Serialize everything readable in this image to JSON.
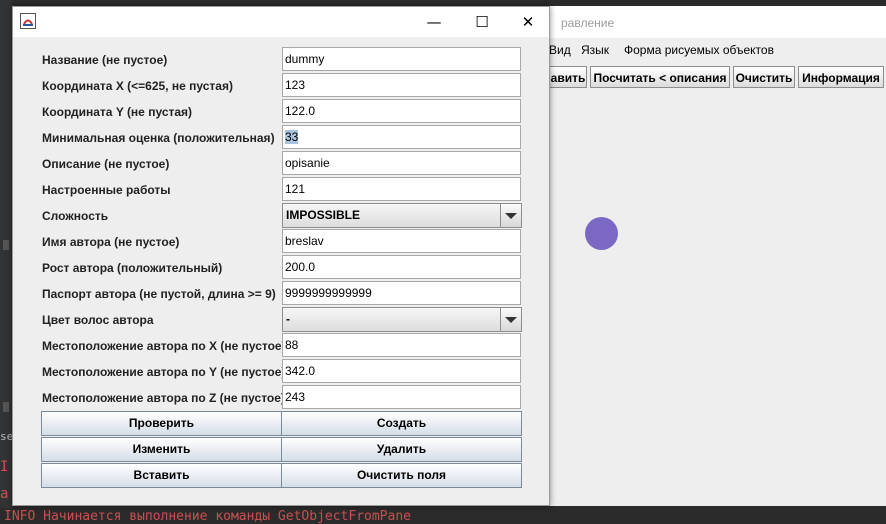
{
  "background": {
    "main_window": {
      "title": "равление",
      "menu": [
        "Вид",
        "Язык",
        "Форма рисуемых объектов"
      ],
      "toolbar": [
        "авить",
        "Посчитать < описания",
        "Очистить",
        "Информация"
      ],
      "circle_color": "#7b68c4"
    },
    "console": {
      "lines": [
        "I",
        "a"
      ],
      "bottom": "INFO  Начинается выполнение команды GetObjectFromPane",
      "side_text": "se"
    }
  },
  "dialog": {
    "title": "",
    "controls": {
      "minimize": "—",
      "maximize": "☐",
      "close": "✕"
    },
    "fields": [
      {
        "label": "Название (не пустое)",
        "value": "dummy"
      },
      {
        "label": "Координата X (<=625, не пустая)",
        "value": "123"
      },
      {
        "label": "Координата Y (не пустая)",
        "value": "122.0"
      },
      {
        "label": "Минимальная оценка (положительная)",
        "value": "33",
        "selected": true
      },
      {
        "label": "Описание (не пустое)",
        "value": "opisanie"
      },
      {
        "label": "Настроенные работы",
        "value": "121"
      },
      {
        "label": "Сложность",
        "value": "IMPOSSIBLE",
        "type": "combo"
      },
      {
        "label": "Имя автора (не пустое)",
        "value": "breslav"
      },
      {
        "label": "Рост автора (положительный)",
        "value": "200.0"
      },
      {
        "label": "Паспорт автора (не пустой, длина >= 9)",
        "value": "9999999999999"
      },
      {
        "label": "Цвет волос автора",
        "value": "-",
        "type": "combo"
      },
      {
        "label": "Местоположение автора по X (не пустое)",
        "value": "88"
      },
      {
        "label": "Местоположение автора по Y (не пустое)",
        "value": "342.0"
      },
      {
        "label": "Местоположение автора по Z (не пустое)",
        "value": "243"
      }
    ],
    "buttons": {
      "check": "Проверить",
      "create": "Создать",
      "edit": "Изменить",
      "delete": "Удалить",
      "insert": "Вставить",
      "clear": "Очистить поля"
    }
  }
}
